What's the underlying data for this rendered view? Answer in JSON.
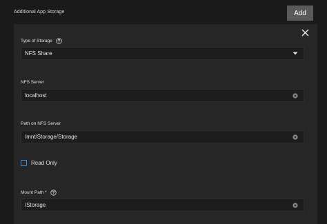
{
  "header": {
    "title": "Additional App Storage",
    "add_label": "Add"
  },
  "fields": {
    "storage_type": {
      "label": "Type of Storage",
      "value": "NFS Share"
    },
    "nfs_server": {
      "label": "NFS Server",
      "value": "localhost"
    },
    "nfs_path": {
      "label": "Path on NFS Server",
      "value": "/mnt/Storage/Storage"
    },
    "read_only": {
      "label": "Read Only",
      "checked": false
    },
    "mount_path": {
      "label": "Mount Path *",
      "value": "/Storage"
    }
  },
  "icons": {
    "close": "close-icon",
    "help": "help-icon",
    "dropdown": "caret-down-icon",
    "clear": "clear-icon"
  },
  "colors": {
    "background": "#1a1a1a",
    "panel": "#262626",
    "input": "#1d1d1d",
    "button": "#5a5a5a",
    "checkbox_accent": "#3d8de0"
  }
}
